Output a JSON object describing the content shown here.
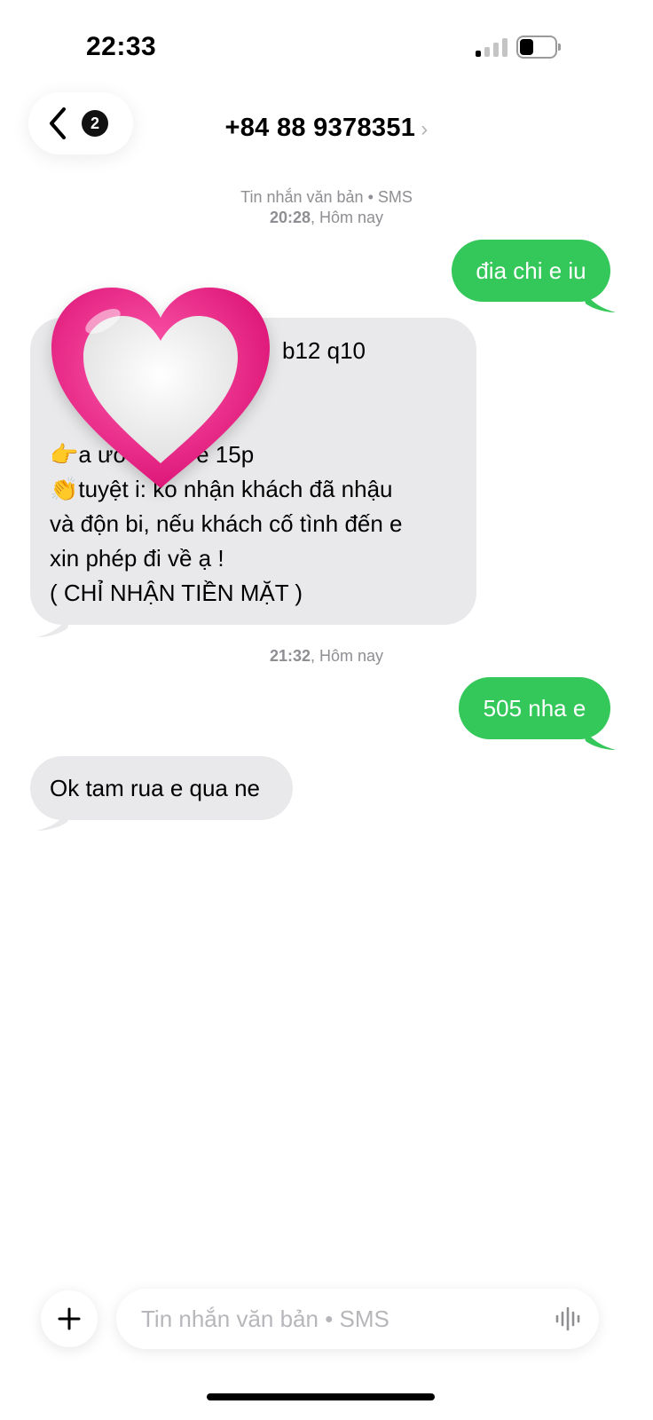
{
  "status_bar": {
    "time": "22:33",
    "battery_percent": 25
  },
  "header": {
    "back_count": "2",
    "contact": "+84 88 9378351",
    "chevron": "›"
  },
  "thread": {
    "meta1": {
      "channel": "Tin nhắn văn bản • SMS",
      "time": "20:28",
      "day": "Hôm nay"
    },
    "msg_out_1": "đia chi e iu",
    "msg_in_1": {
      "lines": [
        "b12 q10",
        "",
        "",
        "👉a                 ước giúp e 15p",
        "👏tuyệt    i: ko nhận khách đã nhậu",
        "và độn bi, nếu khách cố tình đến e",
        "xin phép đi về ạ !",
        "( CHỈ NHẬN TIỀN MẶT )"
      ]
    },
    "meta2": {
      "time": "21:32",
      "day": "Hôm nay"
    },
    "msg_out_2": "505 nha e",
    "msg_in_2": "Ok tam rua e qua ne"
  },
  "composer": {
    "placeholder": "Tin nhắn văn bản • SMS",
    "add_label": "+"
  },
  "colors": {
    "outgoing": "#34c759",
    "incoming": "#e9e9eb",
    "meta": "#8e8e93",
    "heart": "#e8117a"
  },
  "icons": [
    "back-chevron-icon",
    "heart-sticker-icon",
    "plus-icon",
    "audio-waveform-icon",
    "signal-icon",
    "battery-icon"
  ]
}
